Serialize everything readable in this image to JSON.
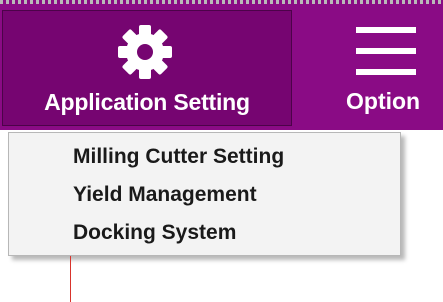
{
  "ribbon": {
    "background_color": "#8a0b85",
    "app_setting": {
      "label": "Application Setting",
      "icon": "gear-icon",
      "color": "#760571"
    },
    "option": {
      "label": "Option",
      "icon": "hamburger-menu-icon"
    }
  },
  "menu": {
    "items": [
      {
        "label": "Milling Cutter Setting"
      },
      {
        "label": "Yield Management"
      },
      {
        "label": "Docking System"
      }
    ]
  }
}
